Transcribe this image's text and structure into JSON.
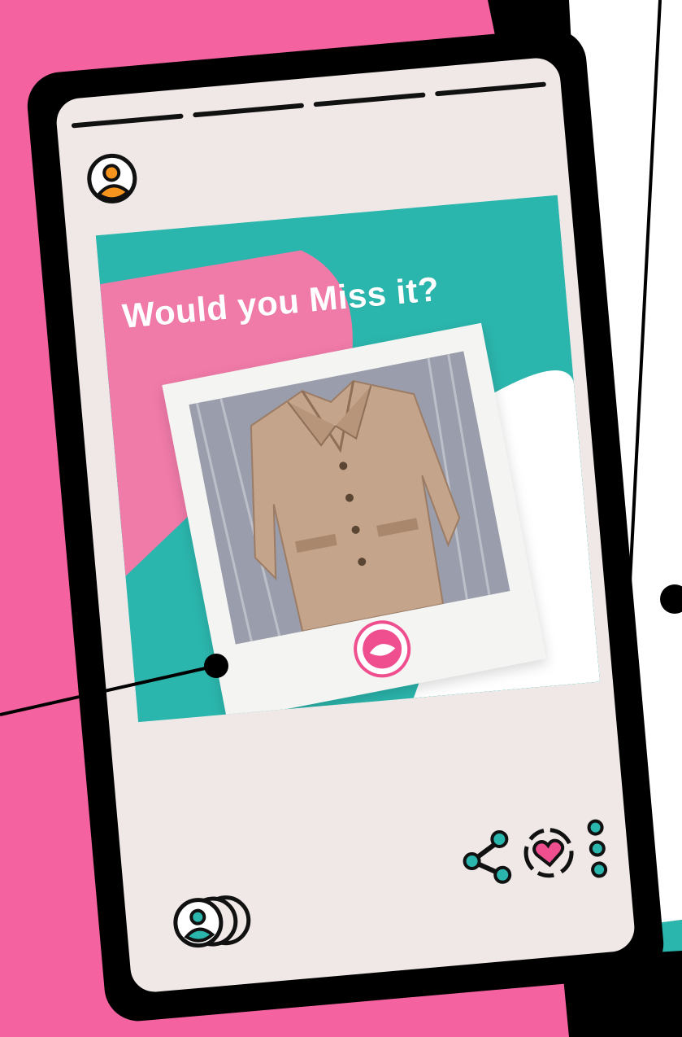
{
  "post": {
    "title": "Would you Miss it?"
  },
  "colors": {
    "background": "#f562a0",
    "teal": "#2bb6ad",
    "pink_block": "#f07aa8",
    "screen": "#efe8e6",
    "avatar_accent": "#f7941d"
  },
  "icons": {
    "profile": "user-circle-icon",
    "share": "share-icon",
    "like": "heart-circle-icon",
    "more": "more-vertical-icon",
    "group": "users-icon"
  }
}
